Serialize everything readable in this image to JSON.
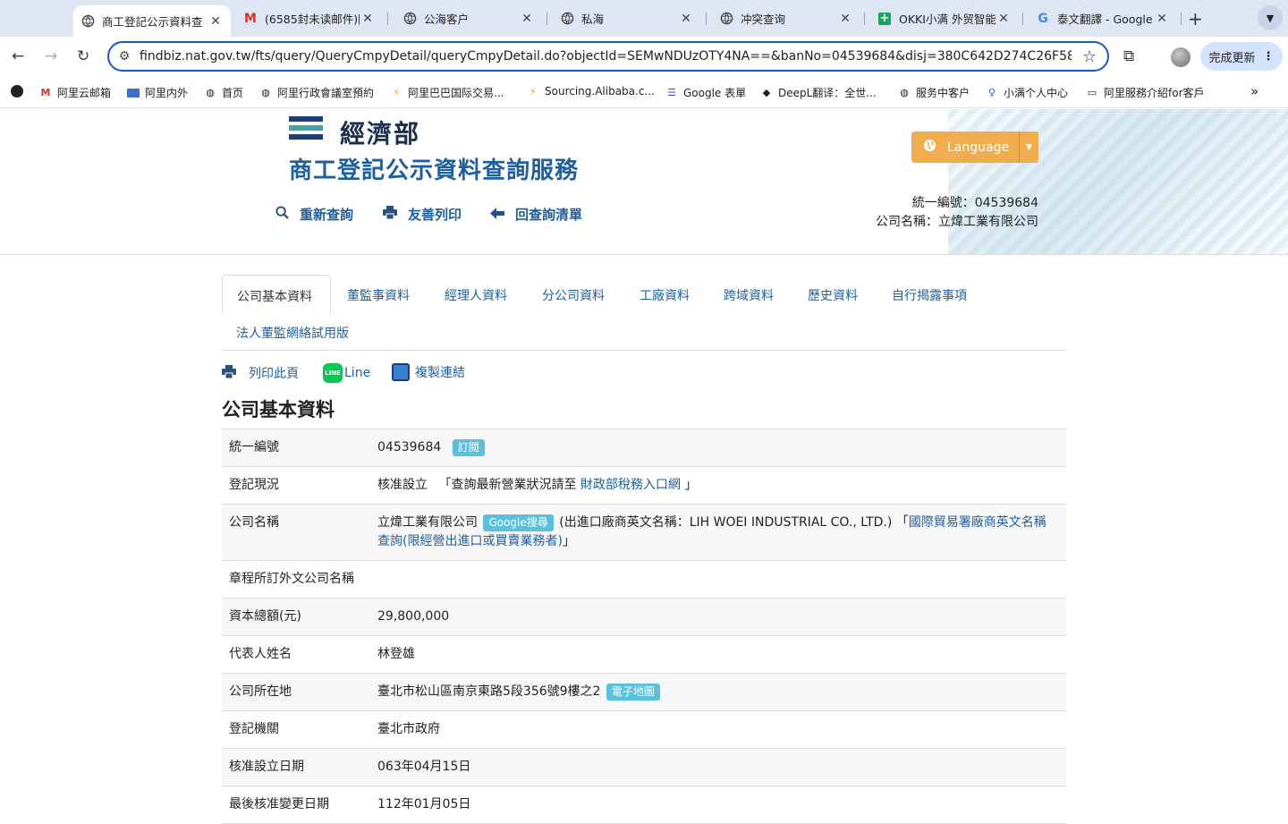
{
  "browser": {
    "tabs": [
      {
        "title": "商工登記公示資料查",
        "active": true
      },
      {
        "title": "(6585封未读邮件)阿"
      },
      {
        "title": "公海客户"
      },
      {
        "title": "私海"
      },
      {
        "title": "冲突查询"
      },
      {
        "title": "OKKI小满 外贸智能"
      },
      {
        "title": "泰文翻譯 - Google"
      }
    ],
    "url": "findbiz.nat.gov.tw/fts/query/QueryCmpyDetail/queryCmpyDetail.do?objectId=SEMwNDUzOTY4NA==&banNo=04539684&disj=380C642D274C26F58B8C...",
    "update_label": "完成更新",
    "bookmarks": [
      "阿里云邮箱",
      "阿里内外",
      "首页",
      "阿里行政會議室預約",
      "阿里巴巴国际交易...",
      "Sourcing.Alibaba.c...",
      "Google 表單",
      "DeepL翻译：全世...",
      "服务中客户",
      "小满个人中心",
      "阿里服務介紹for客戶"
    ]
  },
  "header": {
    "ministry": "經濟部",
    "service_title": "商工登記公示資料查詢服務",
    "links": [
      "重新查詢",
      "友善列印",
      "回查詢清單"
    ],
    "language_label": "Language",
    "ban_line": "統一編號：04539684",
    "company_line": "公司名稱：立煒工業有限公司"
  },
  "tabs": [
    "公司基本資料",
    "董監事資料",
    "經理人資料",
    "分公司資料",
    "工廠資料",
    "跨域資料",
    "歷史資料",
    "自行揭露事項",
    "法人董監網絡試用版"
  ],
  "actions": {
    "print": "列印此頁",
    "line": "Line",
    "line_icon_text": "LINE",
    "copy": "複製連結"
  },
  "section_title": "公司基本資料",
  "rows": {
    "ban": {
      "label": "統一編號",
      "value": "04539684",
      "badge": "訂閱"
    },
    "status": {
      "label": "登記現況",
      "value": "核准設立",
      "pre": "「查詢最新營業狀況請至",
      "link": "財政部稅務入口網",
      "post": "」"
    },
    "name": {
      "label": "公司名稱",
      "value": "立煒工業有限公司",
      "badge": "Google搜尋",
      "en": "(出進口廠商英文名稱：LIH WOEI INDUSTRIAL CO., LTD.)",
      "pre": "「",
      "link": "國際貿易署廠商英文名稱查詢(限經營出進口或買賣業務者)",
      "post": "」"
    },
    "foreign_name": {
      "label": "章程所訂外文公司名稱",
      "value": ""
    },
    "capital": {
      "label": "資本總額(元)",
      "value": "29,800,000"
    },
    "representative": {
      "label": "代表人姓名",
      "value": "林登雄"
    },
    "address": {
      "label": "公司所在地",
      "value": "臺北市松山區南京東路5段356號9樓之2",
      "badge": "電子地圖"
    },
    "authority": {
      "label": "登記機關",
      "value": "臺北市政府"
    },
    "approval_date": {
      "label": "核准設立日期",
      "value": "063年04月15日"
    },
    "last_change": {
      "label": "最後核准變更日期",
      "value": "112年01月05日"
    }
  }
}
